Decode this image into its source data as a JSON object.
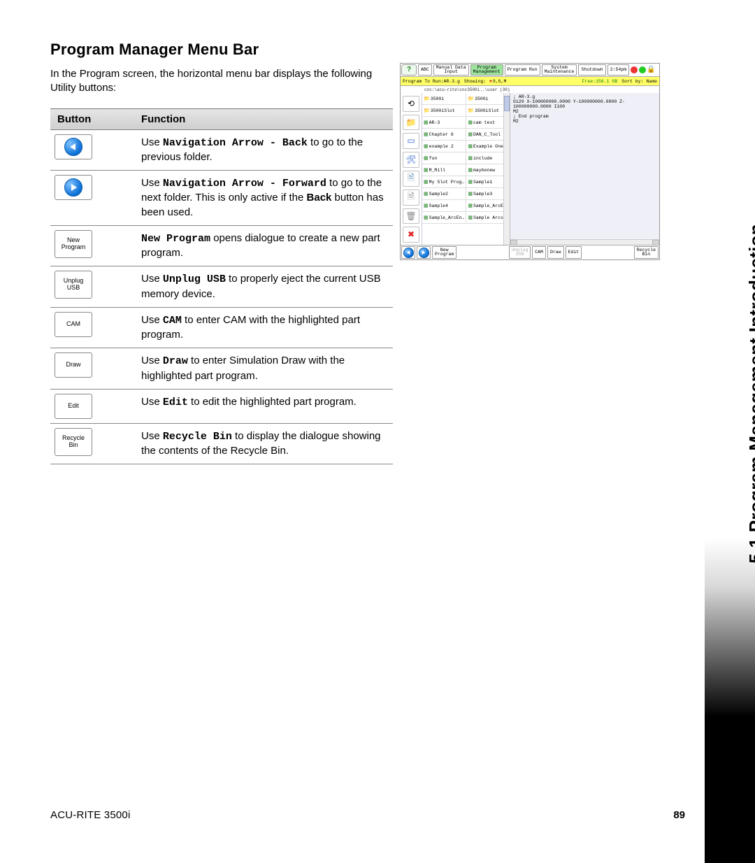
{
  "title": "Program Manager Menu Bar",
  "intro": "In the Program screen, the horizontal menu bar displays the following Utility buttons:",
  "table": {
    "head_button": "Button",
    "head_function": "Function",
    "rows": [
      {
        "bold": "Navigation Arrow - Back",
        "pre": "Use ",
        "post": " to go to the previous folder."
      },
      {
        "bold": "Navigation Arrow - Forward",
        "pre": "Use ",
        "mid": " to go to the next folder. This is only active if the ",
        "bold2": "Back",
        "post": " button has been used."
      },
      {
        "bold": "New Program",
        "pre": "",
        "post": " opens dialogue to create a new part program."
      },
      {
        "bold": "Unplug USB",
        "pre": "Use ",
        "post": " to properly eject the current USB memory device."
      },
      {
        "bold": "CAM",
        "pre": "Use ",
        "post": " to enter CAM with the highlighted part program."
      },
      {
        "bold": "Draw",
        "pre": "Use ",
        "post": " to enter Simulation Draw with the highlighted part program."
      },
      {
        "bold": "Edit",
        "pre": "Use ",
        "post": " to edit the highlighted part program."
      },
      {
        "bold": "Recycle Bin",
        "pre": "Use ",
        "post": " to display the dialogue showing the contents of the Recycle Bin."
      }
    ],
    "btn_labels": [
      "",
      "",
      "New\nProgram",
      "Unplug\nUSB",
      "CAM",
      "Draw",
      "Edit",
      "Recycle\nBin"
    ]
  },
  "shot": {
    "tabs": [
      "ABC",
      "Manual Data\nInput",
      "Program\nManagement",
      "Program Run",
      "System\nMaintenance",
      "Shutdown"
    ],
    "time": "2:54pm",
    "status_prog": "Program To Run:AR-3.g",
    "status_showing": "Showing:",
    "status_star_ext": "9,G,M",
    "status_free": "Free:156.1 GB",
    "status_sort": "Sort by: Name",
    "path": "cnc:\\acu-rite\\cnc3500i..\\user (30)",
    "files_left": [
      "3500i",
      "3500iSlot",
      "AR-3",
      "Chapter 6",
      "example 2",
      "fun",
      "M_Mill",
      "My Slot Prog…",
      "Sample2",
      "Sample4",
      "Sample_ArcEn…"
    ],
    "files_right": [
      "3500i",
      "3500iSlot",
      "cam test",
      "DAN_C_Tool",
      "Example One",
      "include",
      "maybenew",
      "Sample1",
      "Sample3",
      "Sample_ArcEn…",
      "Sample Arcs"
    ],
    "preview_lines": [
      "; AR-3.g",
      "",
      "G120 X-100000000.0000 Y-100000000.0000 Z-100000000.0000 I100",
      "M2",
      "; End program",
      "M2"
    ],
    "bottom": [
      "New\nProgram",
      "Unplug\nUSB",
      "CAM",
      "Draw",
      "Edit",
      "Recycle\nBin"
    ]
  },
  "banner": "5.1 Program Management Introduction",
  "footer_prod": "ACU-RITE 3500i",
  "footer_page": "89"
}
